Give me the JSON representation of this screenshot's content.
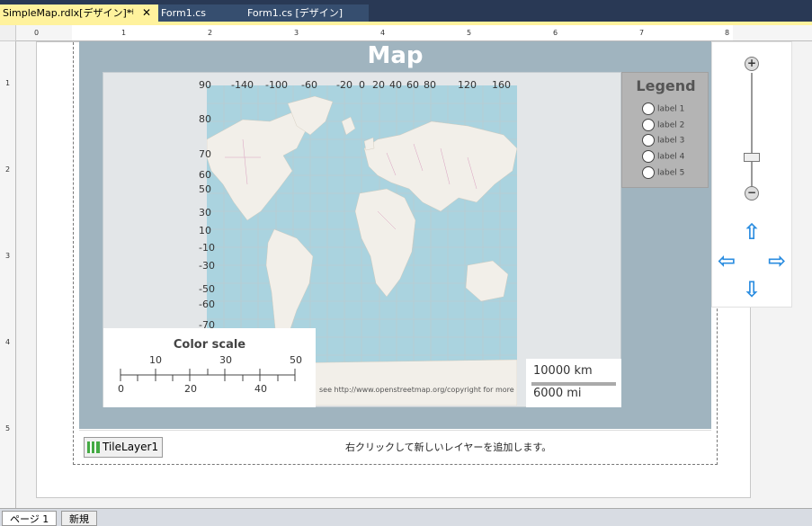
{
  "tabs": [
    {
      "label": "SimpleMap.rdlx[デザイン]*",
      "active": true
    },
    {
      "label": "Form1.cs",
      "active": false
    },
    {
      "label": "Form1.cs [デザイン]",
      "active": false
    }
  ],
  "ruler": {
    "top_numbers": [
      "0",
      "1",
      "2",
      "3",
      "4",
      "5",
      "6",
      "7",
      "8"
    ],
    "left_numbers": [
      "1",
      "2",
      "3",
      "4",
      "5"
    ]
  },
  "map": {
    "title": "Map",
    "longitudes": [
      "-140",
      "-100",
      "-60",
      "-20",
      "0",
      "20",
      "40",
      "60",
      "80",
      "120",
      "160"
    ],
    "latitudes": [
      "90",
      "80",
      "70",
      "60",
      "50",
      "30",
      "10",
      "-10",
      "-30",
      "-50",
      "-60",
      "-70"
    ],
    "attribution": "see  http://www.openstreetmap.org/copyright  for more",
    "color_scale": {
      "title": "Color scale",
      "top_labels": [
        "10",
        "30",
        "50"
      ],
      "bottom_labels": [
        "0",
        "20",
        "40"
      ]
    },
    "distance_scale": {
      "top": "10000 km",
      "bottom": "6000 mi"
    },
    "legend": {
      "title": "Legend",
      "items": [
        "label 1",
        "label 2",
        "label 3",
        "label 4",
        "label 5"
      ]
    }
  },
  "nav": {
    "zoom_in": "+",
    "zoom_out": "−",
    "zoom_level": 0.25,
    "arrows": {
      "up": "⇧",
      "left": "⇦",
      "right": "⇨",
      "down": "⇩"
    }
  },
  "layers": {
    "tile_layer": "TileLayer1",
    "hint": "右クリックして新しいレイヤーを追加します。"
  },
  "bottom_tabs": [
    "ページ 1",
    "新規"
  ]
}
